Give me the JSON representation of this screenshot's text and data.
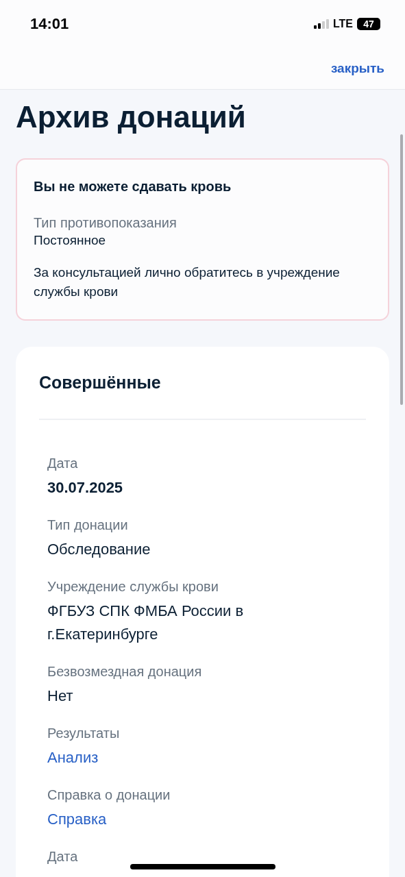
{
  "status_bar": {
    "time": "14:01",
    "network": "LTE",
    "battery": "47"
  },
  "nav": {
    "close": "закрыть"
  },
  "title": "Архив донаций",
  "alert": {
    "title": "Вы не можете сдавать кровь",
    "label": "Тип противопоказания",
    "value": "Постоянное",
    "note": "За консультацией лично обратитесь в учреждение службы крови"
  },
  "card": {
    "title": "Совершённые",
    "fields": [
      {
        "label": "Дата",
        "value": "30.07.2025",
        "kind": "bold"
      },
      {
        "label": "Тип донации",
        "value": "Обследование",
        "kind": "text"
      },
      {
        "label": "Учреждение службы крови",
        "value": "ФГБУЗ СПК ФМБА России в г.Екатеринбурге",
        "kind": "text"
      },
      {
        "label": "Безвозмездная донация",
        "value": "Нет",
        "kind": "text"
      },
      {
        "label": "Результаты",
        "value": "Анализ",
        "kind": "link"
      },
      {
        "label": "Справка о донации",
        "value": "Справка",
        "kind": "link"
      },
      {
        "label": "Дата"
      }
    ]
  }
}
